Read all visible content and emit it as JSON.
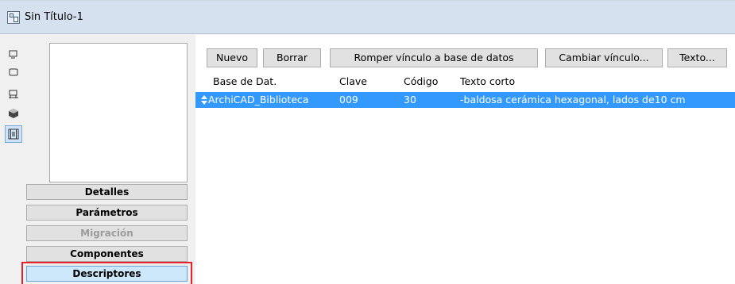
{
  "window": {
    "title": "Sin Título-1"
  },
  "left_tools": [
    {
      "icon": "object-icon",
      "active": false
    },
    {
      "icon": "rectangle-icon",
      "active": false
    },
    {
      "icon": "table-element-icon",
      "active": false
    },
    {
      "icon": "cube-3d-icon",
      "active": false
    },
    {
      "icon": "film-list-icon",
      "active": true
    }
  ],
  "nav_buttons": [
    {
      "label": "Detalles",
      "state": "normal"
    },
    {
      "label": "Parámetros",
      "state": "normal"
    },
    {
      "label": "Migración",
      "state": "disabled"
    },
    {
      "label": "Componentes",
      "state": "normal"
    },
    {
      "label": "Descriptores",
      "state": "selected"
    }
  ],
  "toolbar": {
    "new_label": "Nuevo",
    "delete_label": "Borrar",
    "break_link_label": "Romper vínculo a base de datos",
    "change_link_label": "Cambiar vínculo...",
    "text_label": "Texto..."
  },
  "table": {
    "headers": {
      "database": "Base de Dat.",
      "key": "Clave",
      "code": "Código",
      "short_text": "Texto corto"
    },
    "rows": [
      {
        "database": "ArchiCAD_Biblioteca",
        "key": "009",
        "code": "30",
        "short_text": "-baldosa cerámica hexagonal, lados de10 cm"
      }
    ]
  },
  "colors": {
    "selection": "#3399ff",
    "highlight_border": "#e8222c",
    "titlebar": "#d6e1f0"
  }
}
